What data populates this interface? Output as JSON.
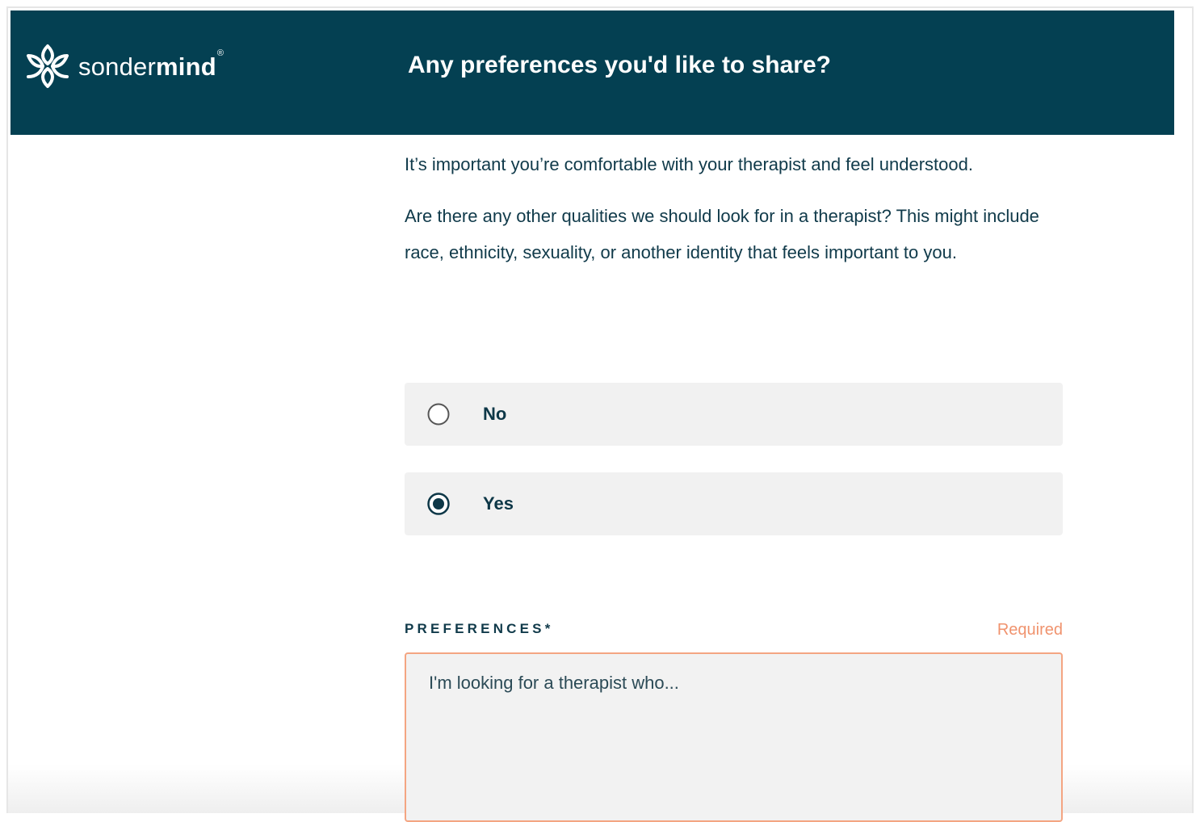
{
  "brand": {
    "name_light": "sonder",
    "name_bold": "mind",
    "registered": "®",
    "logo_icon": "sondermind-flower-icon"
  },
  "header": {
    "title": "Any preferences you'd like to share?"
  },
  "body": {
    "intro": "It’s important you’re comfortable with your therapist and feel understood.",
    "question": "Are there any other qualities we should look for in a therapist? This might include race, ethnicity, sexuality, or another identity that feels important to you."
  },
  "options": [
    {
      "label": "No",
      "selected": false
    },
    {
      "label": "Yes",
      "selected": true
    }
  ],
  "preferences": {
    "label": "PREFERENCES*",
    "required_text": "Required",
    "placeholder": "I'm looking for a therapist who...",
    "value": ""
  },
  "colors": {
    "header_bg": "#044052",
    "text_primary": "#103a4a",
    "option_bg": "#f1f1f1",
    "required_accent": "#f0936e",
    "textarea_border": "#f4a582"
  }
}
